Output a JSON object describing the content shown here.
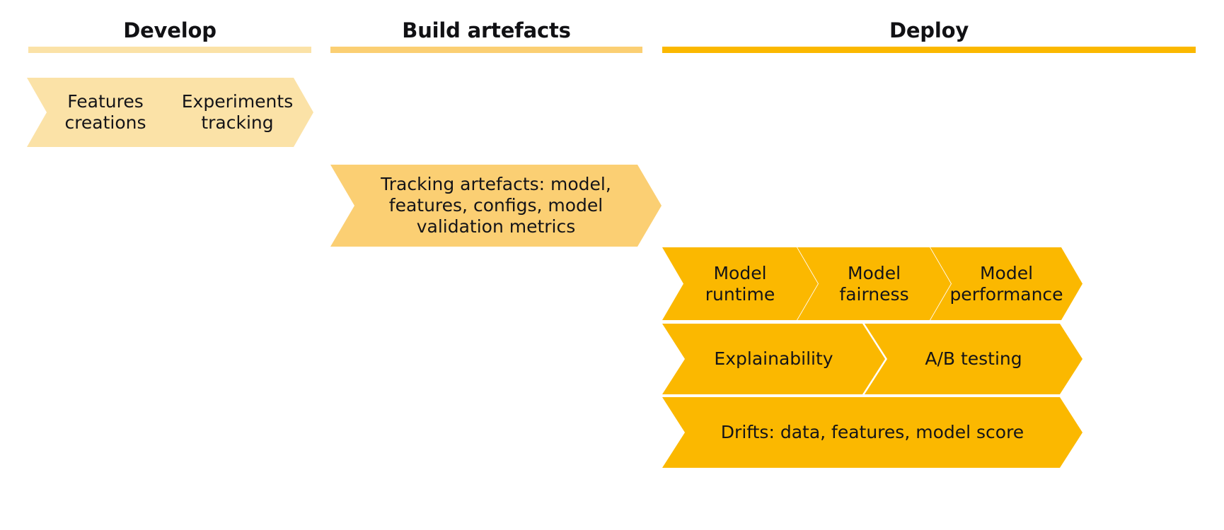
{
  "diagram": {
    "title_develop": "Develop",
    "title_build": "Build artefacts",
    "title_deploy": "Deploy",
    "colors": {
      "light": "#FBE2A7",
      "medium": "#FBCF73",
      "strong": "#FBB800",
      "text": "#141418",
      "background": "#FFFFFF"
    }
  },
  "columns": [
    {
      "key": "develop",
      "header": "Develop",
      "tone": "light",
      "rows": [
        {
          "steps": [
            {
              "label": "Features\ncreations"
            },
            {
              "label": "Experiments\ntracking"
            }
          ]
        }
      ]
    },
    {
      "key": "build_artefacts",
      "header": "Build artefacts",
      "tone": "medium",
      "rows": [
        {
          "steps": [
            {
              "label": "Tracking artefacts: model,\nfeatures, configs, model\nvalidation metrics"
            }
          ]
        }
      ]
    },
    {
      "key": "deploy",
      "header": "Deploy",
      "tone": "strong",
      "rows": [
        {
          "steps": [
            {
              "label": "Model\nruntime"
            },
            {
              "label": "Model\nfairness"
            },
            {
              "label": "Model\nperformance"
            }
          ]
        },
        {
          "steps": [
            {
              "label": "Explainability"
            },
            {
              "label": "A/B testing"
            }
          ]
        },
        {
          "steps": [
            {
              "label": "Drifts: data, features, model score"
            }
          ]
        }
      ]
    }
  ]
}
